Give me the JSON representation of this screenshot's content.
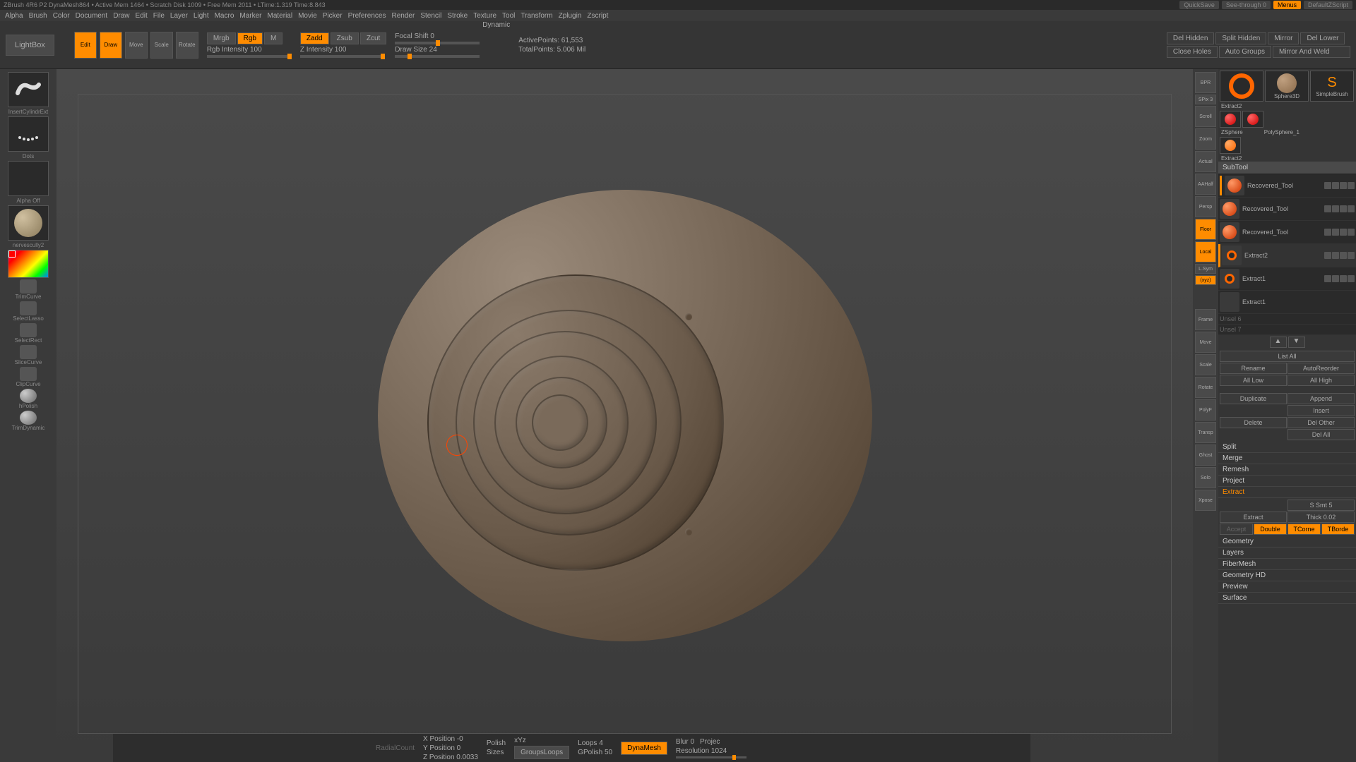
{
  "titlebar": {
    "left": "ZBrush 4R6 P2    DynaMesh864 • Active Mem 1464 • Scratch Disk 1009 • Free Mem 2011 • LTime:1.319  Time:8.843",
    "quicksave": "QuickSave",
    "seethrough": "See-through  0",
    "menus": "Menus",
    "zscript": "DefaultZScript"
  },
  "menubar": [
    "Alpha",
    "Brush",
    "Color",
    "Document",
    "Draw",
    "Edit",
    "File",
    "Layer",
    "Light",
    "Macro",
    "Marker",
    "Material",
    "Movie",
    "Picker",
    "Preferences",
    "Render",
    "Stencil",
    "Stroke",
    "Texture",
    "Tool",
    "Transform",
    "Zplugin",
    "Zscript"
  ],
  "toolbar": {
    "lightbox": "LightBox",
    "edit": "Edit",
    "draw": "Draw",
    "move": "Move",
    "scale": "Scale",
    "rotate": "Rotate",
    "mrgb": "Mrgb",
    "rgb": "Rgb",
    "m": "M",
    "rgb_intensity": "Rgb Intensity 100",
    "zadd": "Zadd",
    "zsub": "Zsub",
    "zcut": "Zcut",
    "z_intensity": "Z Intensity 100",
    "focal_shift": "Focal Shift 0",
    "draw_size": "Draw Size 24",
    "dynamic": "Dynamic",
    "active_points": "ActivePoints: 61,553",
    "total_points": "TotalPoints: 5.006 Mil",
    "del_hidden": "Del Hidden",
    "close_holes": "Close Holes",
    "split_hidden": "Split Hidden",
    "auto_groups": "Auto Groups",
    "mirror": "Mirror",
    "mirror_weld": "Mirror And Weld",
    "del_lower": "Del Lower"
  },
  "left_tools": {
    "brush": "InsertCylindrExt",
    "stroke": "Dots",
    "alpha": "Alpha Off",
    "material": "nervescully2",
    "t1": "TrimCurve",
    "t2": "SelectLasso",
    "t3": "SelectRect",
    "t4": "SliceCurve",
    "t5": "ClipCurve",
    "t6": "hPolish",
    "t7": "TrimDynamic"
  },
  "right_tools": {
    "bpr": "BPR",
    "spix": "SPix 3",
    "scroll": "Scroll",
    "zoom": "Zoom",
    "actual": "Actual",
    "aahalf": "AAHalf",
    "persp": "Persp",
    "floor": "Floor",
    "local": "Local",
    "lsym": "L.Sym",
    "xyz": "(xyz)",
    "frame": "Frame",
    "move": "Move",
    "scale": "Scale",
    "rotate": "Rotate",
    "polyf": "PolyF",
    "transp": "Transp",
    "ghost": "Ghost",
    "solo": "Solo",
    "xpose": "Xpose"
  },
  "thumbs": {
    "extract2": "Extract2",
    "sphere3d": "Sphere3D",
    "zsphere": "ZSphere",
    "simplebrush": "SimpleBrush",
    "polysphere": "PolySphere_1",
    "extract2b": "Extract2"
  },
  "subtool": {
    "header": "SubTool",
    "items": [
      {
        "name": "Recovered_Tool"
      },
      {
        "name": "Recovered_Tool"
      },
      {
        "name": "Recovered_Tool"
      },
      {
        "name": "Extract2"
      },
      {
        "name": "Extract1"
      },
      {
        "name": "Extract1"
      }
    ],
    "unsel1": "Unsel 6",
    "unsel2": "Unsel 7",
    "list_all": "List All",
    "rename": "Rename",
    "autoreorder": "AutoReorder",
    "all_low": "All Low",
    "all_high": "All High",
    "duplicate": "Duplicate",
    "append": "Append",
    "insert": "Insert",
    "delete": "Delete",
    "del_other": "Del Other",
    "del_all": "Del All",
    "split": "Split",
    "merge": "Merge",
    "remesh": "Remesh",
    "project": "Project",
    "extract": "Extract",
    "s_smt": "S Smt 5",
    "thick": "Thick 0.02",
    "extract_btn": "Extract",
    "accept": "Accept",
    "double": "Double",
    "tcorne": "TCorne",
    "tborde": "TBorde"
  },
  "sections": [
    "Geometry",
    "Layers",
    "FiberMesh",
    "Geometry HD",
    "Preview",
    "Surface"
  ],
  "bottom": {
    "xpos": "X Position  -0",
    "ypos": "Y Position  0",
    "zpos": "Z Position 0.0033",
    "polish": "Polish",
    "sizes": "Sizes",
    "xyz": "xYz",
    "groupsloops": "GroupsLoops",
    "loops": "Loops 4",
    "gpolish": "GPolish 50",
    "dynamesh": "DynaMesh",
    "blur": "Blur 0",
    "project": "Projec",
    "resolution": "Resolution 1024",
    "radialcount": "RadialCount"
  }
}
